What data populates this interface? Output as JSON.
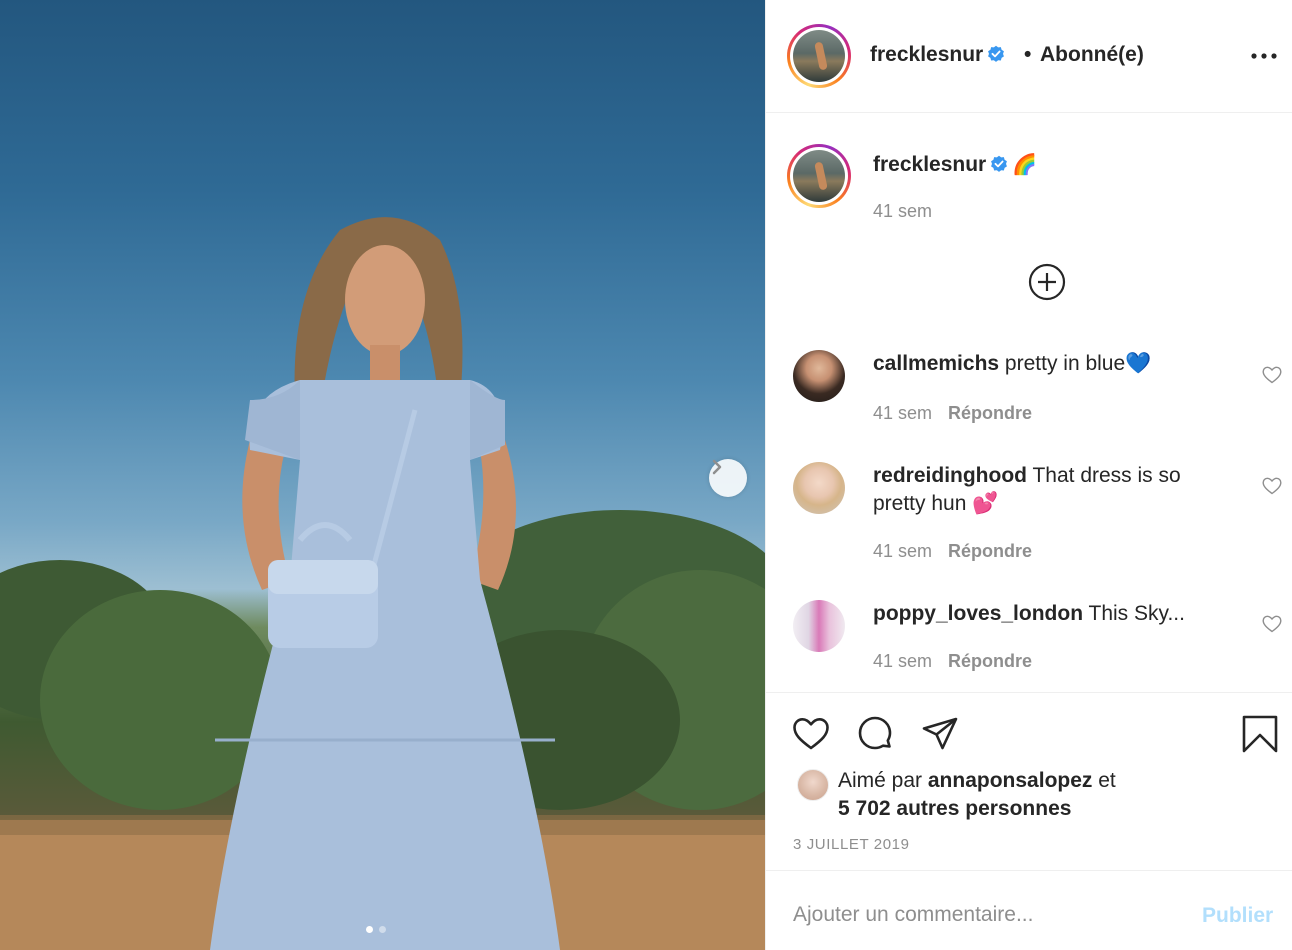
{
  "post": {
    "username": "frecklesnur",
    "separator": "•",
    "follow_status": "Abonné(e)",
    "caption_emoji": "🌈",
    "caption_time": "41 sem",
    "image_count": 2,
    "active_image": 1
  },
  "comments": [
    {
      "user": "callmemichs",
      "text": "pretty in blue💙",
      "time": "41 sem",
      "reply": "Répondre"
    },
    {
      "user": "redreidinghood",
      "text": "That dress is so pretty hun 💕",
      "time": "41 sem",
      "reply": "Répondre"
    },
    {
      "user": "poppy_loves_london",
      "text": "This Sky...",
      "time": "41 sem",
      "reply": "Répondre"
    }
  ],
  "likes": {
    "prefix": "Aimé par",
    "liker": "annaponsalopez",
    "conj": "et",
    "others": "5 702 autres personnes"
  },
  "date": "3 JUILLET 2019",
  "comment_box": {
    "placeholder": "Ajouter un commentaire...",
    "publish": "Publier"
  },
  "icons": {
    "verified": "verified-badge-icon",
    "more": "more-options-icon",
    "load_more": "add-circle-icon",
    "like": "heart-icon",
    "comment": "comment-bubble-icon",
    "share": "paper-plane-icon",
    "save": "bookmark-icon",
    "next": "chevron-right-icon"
  },
  "colors": {
    "verified_blue": "#3897f0",
    "text_primary": "#262626",
    "text_secondary": "#8e8e8e",
    "publish_disabled": "#b2dffc"
  }
}
